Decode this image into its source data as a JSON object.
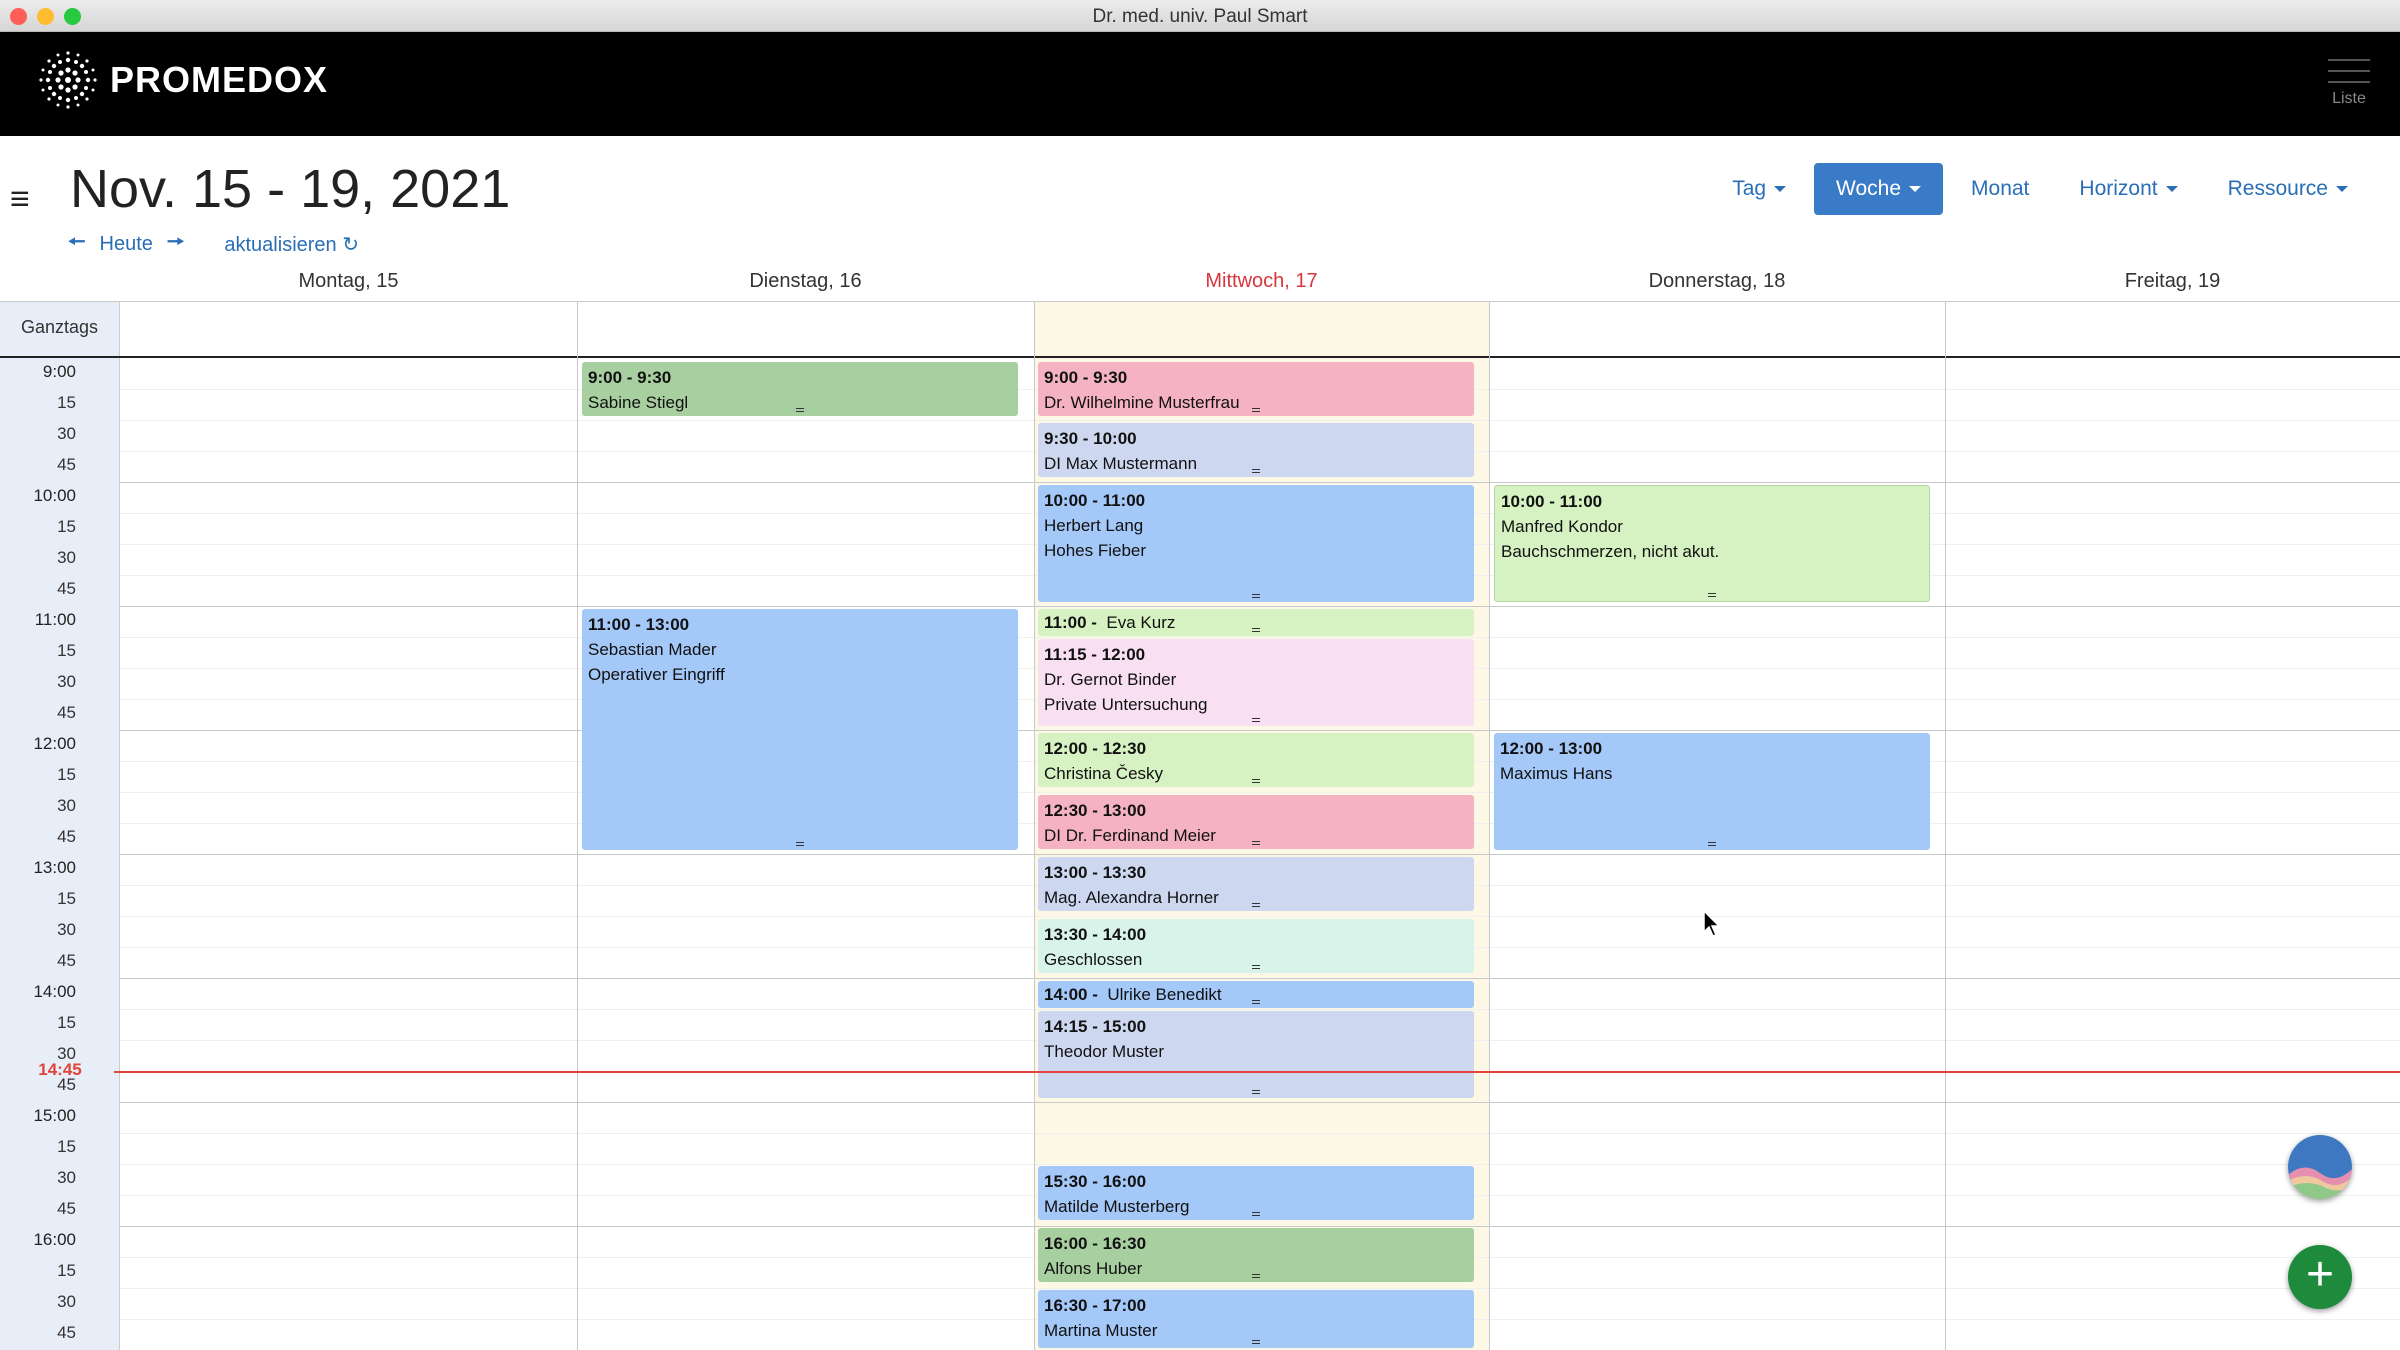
{
  "window": {
    "title": "Dr. med. univ. Paul Smart"
  },
  "navbar": {
    "brand": "PROMEDOX",
    "list_label": "Liste"
  },
  "header": {
    "date_range": "Nov. 15 - 19, 2021",
    "today_label": "Heute",
    "refresh_label": "aktualisieren"
  },
  "views": {
    "day": "Tag",
    "week": "Woche",
    "month": "Monat",
    "horizon": "Horizont",
    "resource": "Ressource"
  },
  "days": [
    "Montag, 15",
    "Dienstag, 16",
    "Mittwoch, 17",
    "Donnerstag, 18",
    "Freitag, 19"
  ],
  "allday_label": "Ganztags",
  "time_labels": [
    "9:00",
    "15",
    "30",
    "45",
    "10:00",
    "15",
    "30",
    "45",
    "11:00",
    "15",
    "30",
    "45",
    "12:00",
    "15",
    "30",
    "45",
    "13:00",
    "15",
    "30",
    "45",
    "14:00",
    "15",
    "30",
    "45",
    "15:00",
    "15",
    "30",
    "45",
    "16:00",
    "15",
    "30",
    "45"
  ],
  "now_label": "14:45",
  "colors": {
    "today_heading": "#d9363e",
    "now_line": "#e0443a",
    "accent": "#3a7bc8"
  },
  "events": [
    {
      "time": "9:00 - 9:30",
      "name": "Sabine Stiegl",
      "note": ""
    },
    {
      "time": "11:00 - 13:00",
      "name": "Sebastian Mader",
      "note": "Operativer Eingriff"
    },
    {
      "time": "9:00 - 9:30",
      "name": "Dr. Wilhelmine Musterfrau",
      "note": ""
    },
    {
      "time": "9:30 - 10:00",
      "name": "DI Max Mustermann",
      "note": ""
    },
    {
      "time": "10:00 - 11:00",
      "name": "Herbert Lang",
      "note": "Hohes Fieber"
    },
    {
      "time": "11:00 -",
      "name": "Eva Kurz",
      "note": ""
    },
    {
      "time": "11:15 - 12:00",
      "name": "Dr. Gernot Binder",
      "note": "Private Untersuchung"
    },
    {
      "time": "12:00 - 12:30",
      "name": "Christina Česky",
      "note": ""
    },
    {
      "time": "12:30 - 13:00",
      "name": "DI Dr. Ferdinand Meier",
      "note": ""
    },
    {
      "time": "13:00 - 13:30",
      "name": "Mag. Alexandra Horner",
      "note": ""
    },
    {
      "time": "13:30 - 14:00",
      "name": "Geschlossen",
      "note": ""
    },
    {
      "time": "14:00 -",
      "name": "Ulrike Benedikt",
      "note": ""
    },
    {
      "time": "14:15 - 15:00",
      "name": "Theodor Muster",
      "note": ""
    },
    {
      "time": "15:30 - 16:00",
      "name": "Matilde Musterberg",
      "note": ""
    },
    {
      "time": "16:00 - 16:30",
      "name": "Alfons Huber",
      "note": ""
    },
    {
      "time": "16:30 - 17:00",
      "name": "Martina Muster",
      "note": ""
    },
    {
      "time": "10:00 - 11:00",
      "name": "Manfred Kondor",
      "note": "Bauchschmerzen, nicht akut."
    },
    {
      "time": "12:00 - 13:00",
      "name": "Maximus Hans",
      "note": ""
    }
  ]
}
